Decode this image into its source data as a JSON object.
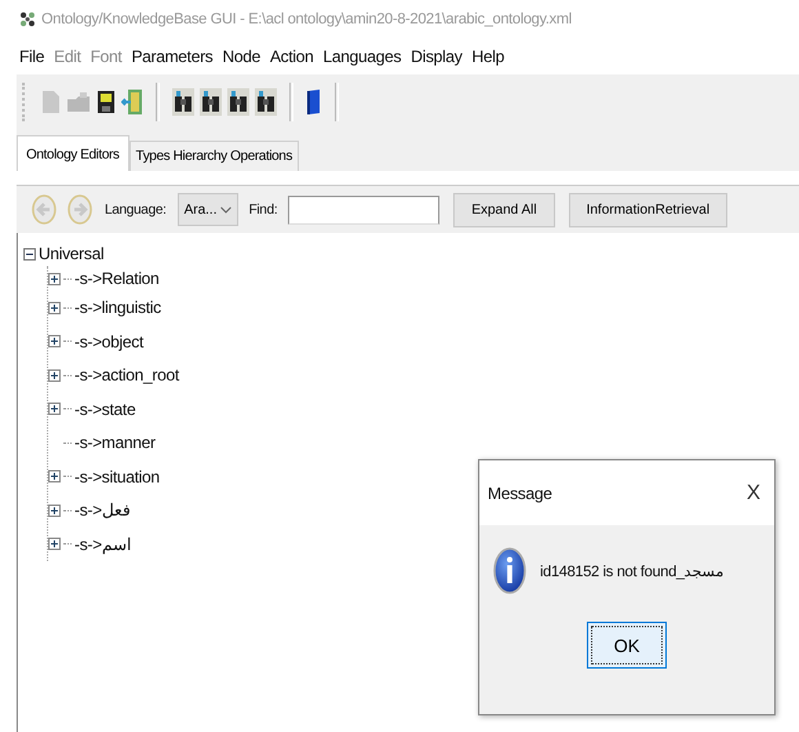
{
  "window": {
    "title": "Ontology/KnowledgeBase GUI - E:\\acl ontology\\amin20-8-2021\\arabic_ontology.xml"
  },
  "menu": [
    {
      "label": "File",
      "disabled": false
    },
    {
      "label": "Edit",
      "disabled": true
    },
    {
      "label": "Font",
      "disabled": true
    },
    {
      "label": "Parameters",
      "disabled": false
    },
    {
      "label": "Node",
      "disabled": false
    },
    {
      "label": "Action",
      "disabled": false
    },
    {
      "label": "Languages",
      "disabled": false
    },
    {
      "label": "Display",
      "disabled": false
    },
    {
      "label": "Help",
      "disabled": false
    }
  ],
  "toolbar": [
    {
      "kind": "page",
      "disabled": true
    },
    {
      "kind": "folder",
      "disabled": true
    },
    {
      "kind": "floppy",
      "disabled": false
    },
    {
      "kind": "door",
      "disabled": false
    },
    {
      "kind": "sep"
    },
    {
      "kind": "binoculars",
      "disabled": false
    },
    {
      "kind": "binoculars",
      "disabled": false
    },
    {
      "kind": "binoculars",
      "disabled": false
    },
    {
      "kind": "binoculars",
      "disabled": false
    },
    {
      "kind": "sep"
    },
    {
      "kind": "book",
      "disabled": false
    }
  ],
  "tabs": [
    {
      "label": "Ontology Editors",
      "selected": true
    },
    {
      "label": "Types Hierarchy Operations",
      "selected": false
    }
  ],
  "editor": {
    "language_label": "Language:",
    "language_value": "Ara...",
    "find_label": "Find:",
    "buttons": [
      "Expand All",
      "InformationRetrieval"
    ]
  },
  "tree": {
    "label": "Universal",
    "expanded": true,
    "children": [
      {
        "label": "-s->Relation",
        "has_children": true
      },
      {
        "label": "-s->linguistic",
        "has_children": true
      },
      {
        "label": "-s->object",
        "has_children": true
      },
      {
        "label": "-s->action_root",
        "has_children": true
      },
      {
        "label": "-s->state",
        "has_children": true
      },
      {
        "label": "-s->manner",
        "has_children": false
      },
      {
        "label": "-s->situation",
        "has_children": true
      },
      {
        "label": "-s->فعل",
        "has_children": true
      },
      {
        "label": "-s->اسم",
        "has_children": true
      }
    ]
  },
  "dialog": {
    "title": "Message",
    "close": "X",
    "message": "id148152 is not found_مسجد",
    "button": "OK"
  }
}
